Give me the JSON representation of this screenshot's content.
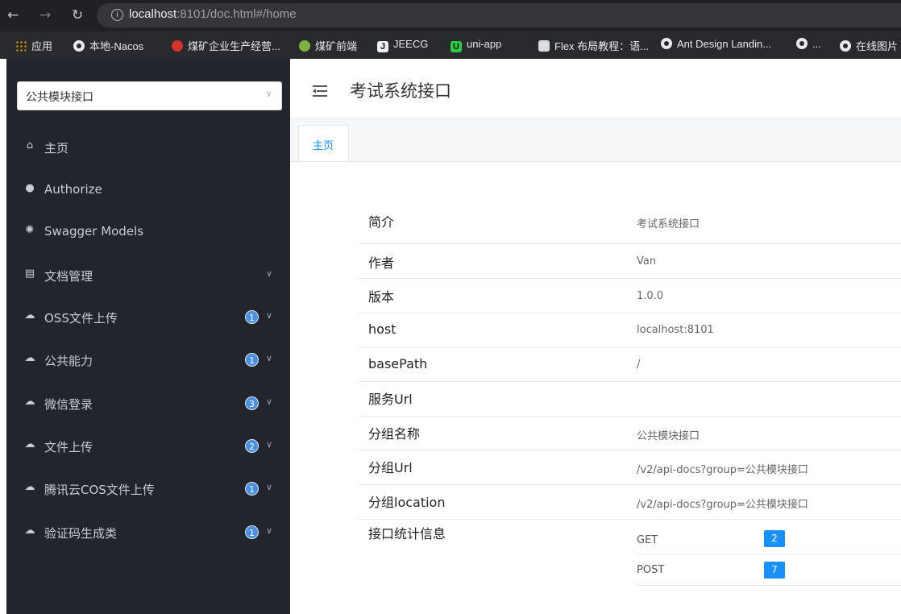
{
  "browser": {
    "url_host": "localhost",
    "url_rest": ":8101/doc.html#/home",
    "bookmarks": [
      {
        "label": "应用",
        "icon": "apps-icon"
      },
      {
        "label": "本地-Nacos",
        "icon": "globe-icon"
      },
      {
        "label": "煤矿企业生产经营...",
        "icon": "emblem-icon"
      },
      {
        "label": "煤矿前端",
        "icon": "site-icon"
      },
      {
        "label": "JEECG",
        "icon": "jeecg-icon"
      },
      {
        "label": "uni-app",
        "icon": "uniapp-icon"
      },
      {
        "label": "Flex 布局教程：语...",
        "icon": "flex-icon"
      },
      {
        "label": "Ant Design Landin...",
        "icon": "globe-icon"
      },
      {
        "label": "...",
        "icon": "globe-icon"
      },
      {
        "label": "在线图片",
        "icon": "globe-icon"
      }
    ]
  },
  "sidebar": {
    "group_select": "公共模块接口",
    "items": [
      {
        "label": "主页",
        "icon": "home-icon"
      },
      {
        "label": "Authorize",
        "icon": "lock-icon"
      },
      {
        "label": "Swagger Models",
        "icon": "models-icon"
      },
      {
        "label": "文档管理",
        "icon": "doc-icon",
        "expandable": true
      },
      {
        "label": "OSS文件上传",
        "icon": "cloud-icon",
        "badge": "1"
      },
      {
        "label": "公共能力",
        "icon": "cloud-icon",
        "badge": "1"
      },
      {
        "label": "微信登录",
        "icon": "cloud-icon",
        "badge": "3"
      },
      {
        "label": "文件上传",
        "icon": "cloud-icon",
        "badge": "2"
      },
      {
        "label": "腾讯云COS文件上传",
        "icon": "cloud-icon",
        "badge": "1"
      },
      {
        "label": "验证码生成类",
        "icon": "cloud-icon",
        "badge": "1"
      }
    ]
  },
  "header": {
    "title": "考试系统接口"
  },
  "tabs": [
    {
      "label": "主页",
      "active": true
    }
  ],
  "info": {
    "rows": [
      {
        "key": "简介",
        "value": "考试系统接口"
      },
      {
        "key": "作者",
        "value": "Van"
      },
      {
        "key": "版本",
        "value": "1.0.0"
      },
      {
        "key": "host",
        "value": "localhost:8101"
      },
      {
        "key": "basePath",
        "value": "/"
      },
      {
        "key": "服务Url",
        "value": ""
      },
      {
        "key": "分组名称",
        "value": "公共模块接口"
      },
      {
        "key": "分组Url",
        "value": "/v2/api-docs?group=公共模块接口"
      },
      {
        "key": "分组location",
        "value": "/v2/api-docs?group=公共模块接口"
      }
    ],
    "stats_label": "接口统计信息",
    "stats": [
      {
        "method": "GET",
        "count": "2"
      },
      {
        "method": "POST",
        "count": "7"
      }
    ]
  },
  "colors": {
    "sidebar_bg": "#22262c",
    "accent": "#1890ff",
    "badge": "#4a90e2"
  }
}
